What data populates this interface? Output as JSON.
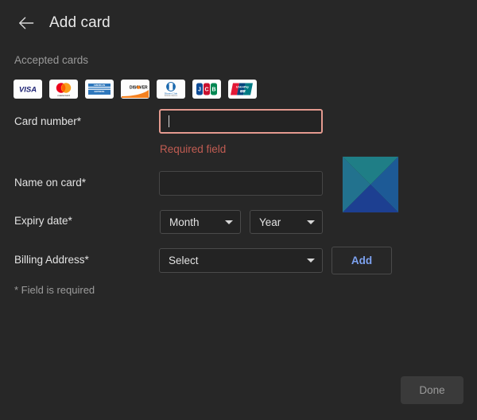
{
  "header": {
    "back_icon": "arrow-left-icon",
    "title": "Add card"
  },
  "accepted_cards": {
    "label": "Accepted cards",
    "brands": [
      {
        "name": "visa",
        "text": "VISA"
      },
      {
        "name": "mastercard",
        "text": "mastercard"
      },
      {
        "name": "american-express",
        "text": "AMERICAN EXPRESS"
      },
      {
        "name": "discover",
        "text": "DISCOVER"
      },
      {
        "name": "diners-club",
        "text": "Diners Club"
      },
      {
        "name": "jcb",
        "text": "JCB"
      },
      {
        "name": "unionpay",
        "text": "UnionPay"
      }
    ]
  },
  "form": {
    "card_number": {
      "label": "Card number*",
      "value": "",
      "placeholder": "",
      "error": "Required field"
    },
    "name_on_card": {
      "label": "Name on card*",
      "value": "",
      "placeholder": ""
    },
    "expiry": {
      "label": "Expiry date*",
      "month": "Month",
      "year": "Year"
    },
    "billing_address": {
      "label": "Billing Address*",
      "value": "Select",
      "add_label": "Add"
    },
    "footnote": "* Field is required"
  },
  "footer": {
    "done_label": "Done"
  },
  "colors": {
    "background": "#272727",
    "input_background": "#232323",
    "error_border": "#e49a8f",
    "error_text": "#c15c52",
    "link": "#7da2f0",
    "preview_teal": "#1f7e86",
    "preview_blue": "#1d3f91"
  }
}
